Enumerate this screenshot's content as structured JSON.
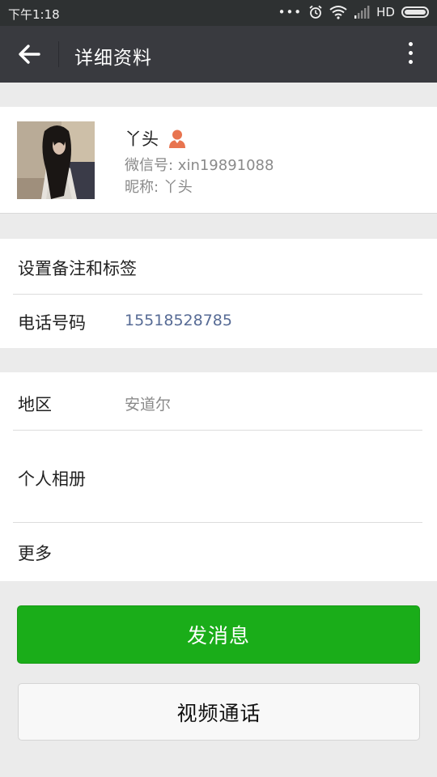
{
  "status_bar": {
    "time": "下午1:18",
    "dots": "•••",
    "network": "HD"
  },
  "app_bar": {
    "title": "详细资料"
  },
  "profile": {
    "name": "丫头",
    "wechat_id": "微信号: xin19891088",
    "nickname": "昵称: 丫头",
    "gender": "female"
  },
  "rows": {
    "remark_tags": {
      "label": "设置备注和标签"
    },
    "phone": {
      "label": "电话号码",
      "value": "15518528785"
    },
    "region": {
      "label": "地区",
      "value": "安道尔"
    },
    "album": {
      "label": "个人相册"
    },
    "more": {
      "label": "更多"
    }
  },
  "buttons": {
    "send_message": "发消息",
    "video_call": "视频通话"
  },
  "colors": {
    "accent_green": "#1aad19",
    "phone_link": "#576b95",
    "gender_icon": "#e8744f",
    "header_bg": "#393a3f"
  }
}
